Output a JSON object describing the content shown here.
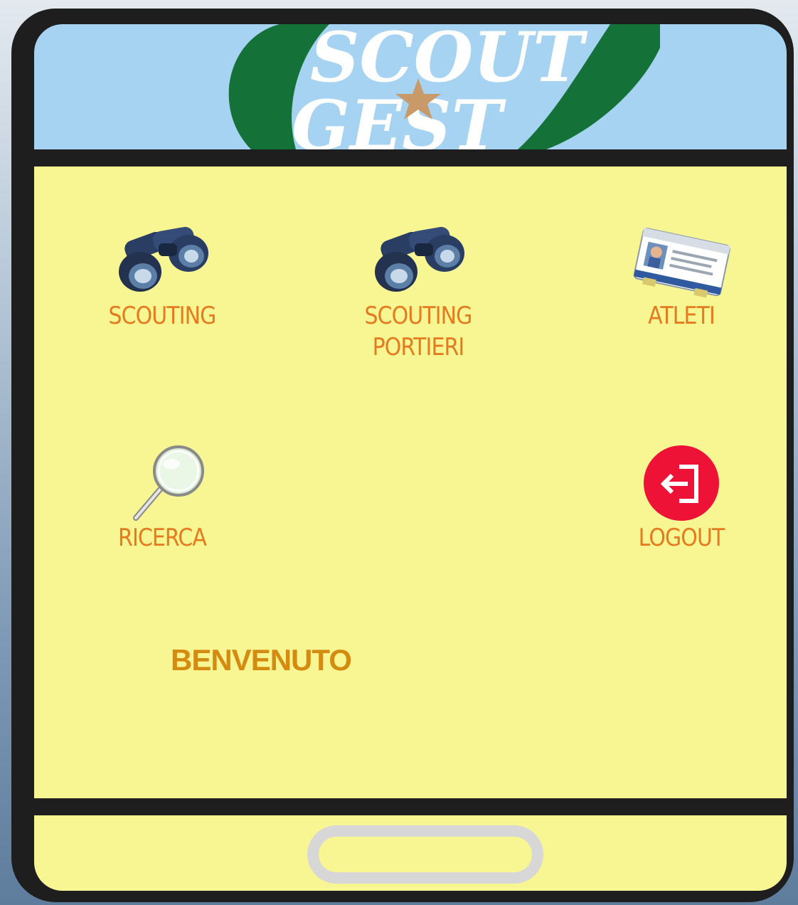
{
  "app": {
    "logo_line1": "SCOUT",
    "logo_line2": "GEST"
  },
  "menu": [
    {
      "label": "SCOUTING",
      "icon": "binoculars-icon"
    },
    {
      "label": "SCOUTING\nPORTIERI",
      "icon": "binoculars-icon"
    },
    {
      "label": "ATLETI",
      "icon": "id-card-icon"
    },
    {
      "label": "RICERCA",
      "icon": "magnifier-icon"
    },
    {
      "label": "LOGOUT",
      "icon": "logout-icon"
    }
  ],
  "welcome": "BENVENUTO",
  "colors": {
    "screen_bg": "#f8f593",
    "header_bg": "#a7d3f2",
    "label": "#e57a1e",
    "welcome": "#d58a10",
    "leaf": "#147238",
    "logout": "#ee1237"
  }
}
